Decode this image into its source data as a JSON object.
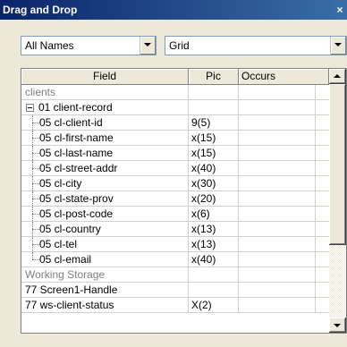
{
  "window": {
    "title": "Drag and Drop",
    "close_glyph": "×"
  },
  "filters": {
    "names_value": "All Names",
    "view_value": "Grid"
  },
  "grid": {
    "columns": [
      "Field",
      "Pic",
      "Occurs"
    ],
    "rows": [
      {
        "field": "clients",
        "pic": "",
        "occurs": "",
        "style": "section"
      },
      {
        "field": "01  client-record",
        "pic": "",
        "occurs": "",
        "style": "group"
      },
      {
        "field": "05  cl-client-id",
        "pic": "9(5)",
        "occurs": "",
        "style": "child"
      },
      {
        "field": "05  cl-first-name",
        "pic": "x(15)",
        "occurs": "",
        "style": "child"
      },
      {
        "field": "05  cl-last-name",
        "pic": "x(15)",
        "occurs": "",
        "style": "child"
      },
      {
        "field": "05  cl-street-addr",
        "pic": "x(40)",
        "occurs": "",
        "style": "child"
      },
      {
        "field": "05  cl-city",
        "pic": "x(30)",
        "occurs": "",
        "style": "child"
      },
      {
        "field": "05  cl-state-prov",
        "pic": "x(20)",
        "occurs": "",
        "style": "child"
      },
      {
        "field": "05  cl-post-code",
        "pic": "x(6)",
        "occurs": "",
        "style": "child"
      },
      {
        "field": "05  cl-country",
        "pic": "x(13)",
        "occurs": "",
        "style": "child"
      },
      {
        "field": "05  cl-tel",
        "pic": "x(13)",
        "occurs": "",
        "style": "child"
      },
      {
        "field": "05  cl-email",
        "pic": "x(40)",
        "occurs": "",
        "style": "child-last"
      },
      {
        "field": "Working Storage",
        "pic": "",
        "occurs": "",
        "style": "section"
      },
      {
        "field": "77  Screen1-Handle",
        "pic": "",
        "occurs": "",
        "style": "plain"
      },
      {
        "field": "77  ws-client-status",
        "pic": "X(2)",
        "occurs": "",
        "style": "plain"
      }
    ]
  }
}
